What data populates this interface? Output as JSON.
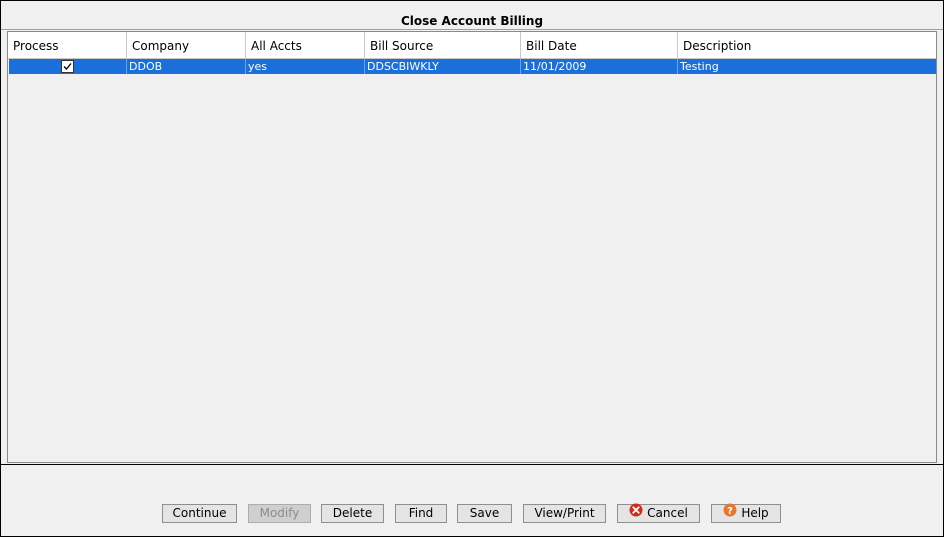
{
  "window": {
    "title": "Close Account Billing"
  },
  "grid": {
    "columns": [
      "Process",
      "Company",
      "All Accts",
      "Bill Source",
      "Bill Date",
      "Description"
    ],
    "rows": [
      {
        "process": true,
        "company": "DDOB",
        "all_accts": "yes",
        "bill_source": "DDSCBIWKLY",
        "bill_date": "11/01/2009",
        "description": "Testing"
      }
    ]
  },
  "buttons": {
    "continue": "Continue",
    "modify": "Modify",
    "delete": "Delete",
    "find": "Find",
    "save": "Save",
    "view_print": "View/Print",
    "cancel": "Cancel",
    "help": "Help"
  },
  "colors": {
    "selection": "#1a6fdb",
    "background": "#f0f0f0"
  }
}
